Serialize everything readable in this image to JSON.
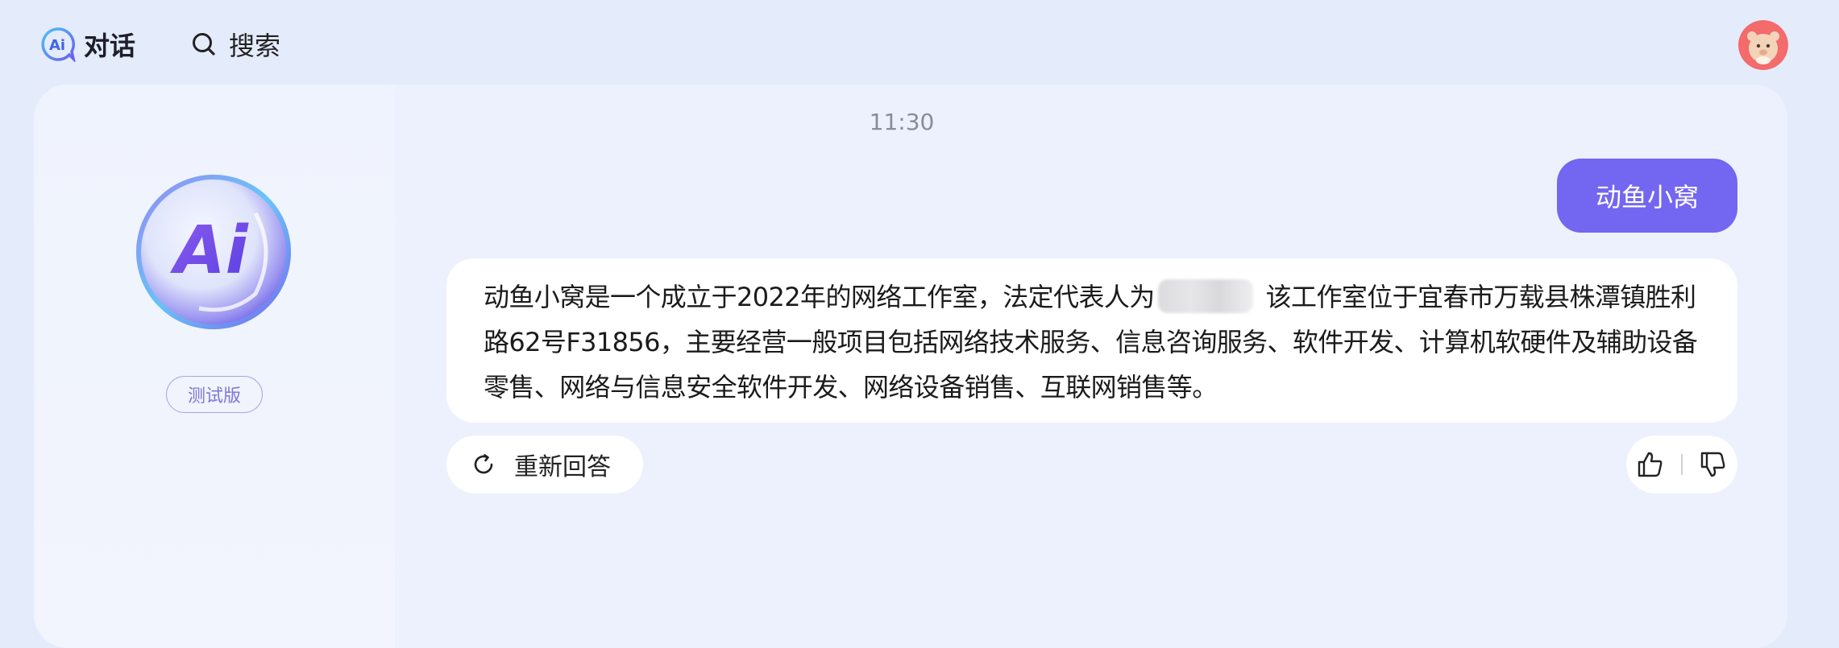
{
  "header": {
    "brand_label": "对话",
    "brand_icon": "ai-logo-icon",
    "search_label": "搜索",
    "search_icon": "search-icon",
    "avatar_icon": "user-avatar"
  },
  "sidebar": {
    "logo_icon": "ai-orb-logo",
    "version_badge": "测试版"
  },
  "chat": {
    "timestamp": "11:30",
    "user_message": "动鱼小窝",
    "bot_message_part1": "动鱼小窝是一个成立于2022年的网络工作室，法定代表人为",
    "bot_message_part2": "该工作室位于宜春市万载县株潭镇胜利路62号F31856，主要经营一般项目包括网络技术服务、信息咨询服务、软件开发、计算机软硬件及辅助设备零售、网络与信息安全软件开发、网络设备销售、互联网销售等。",
    "regenerate_label": "重新回答",
    "regenerate_icon": "refresh-icon",
    "like_icon": "thumbs-up-icon",
    "dislike_icon": "thumbs-down-icon"
  },
  "colors": {
    "accent": "#7366f0",
    "background": "#e4ebfb",
    "badge": "#7d78d4"
  }
}
